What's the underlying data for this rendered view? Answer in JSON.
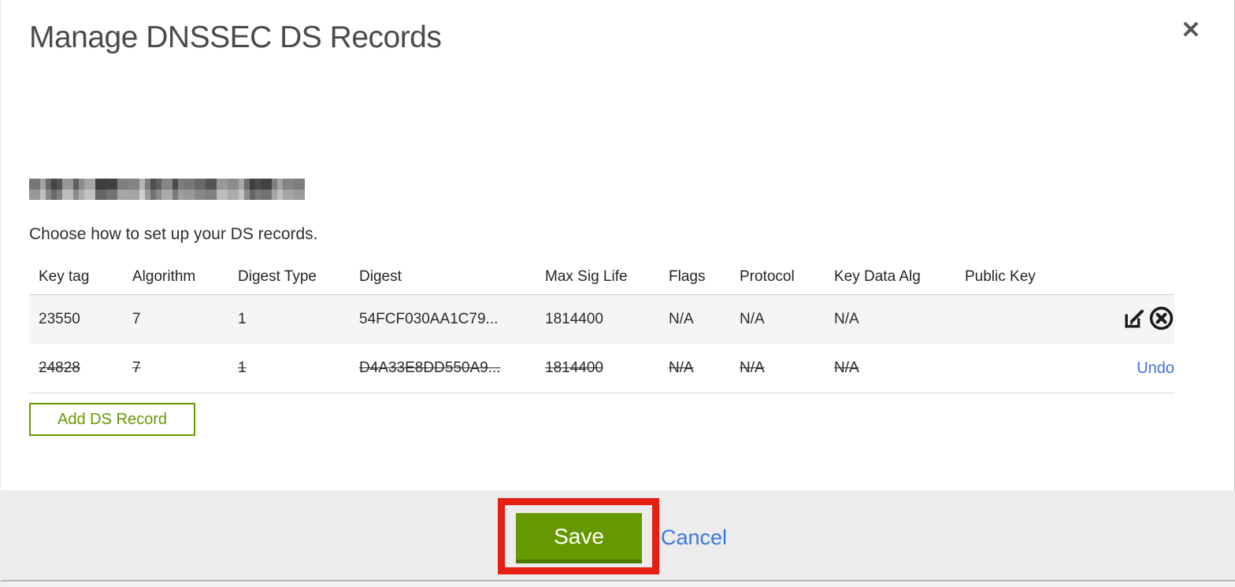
{
  "modal": {
    "title": "Manage DNSSEC DS Records",
    "close_icon": "✕",
    "instruction": "Choose how to set up your DS records.",
    "domain_redacted": true
  },
  "table": {
    "columns": [
      "Key tag",
      "Algorithm",
      "Digest Type",
      "Digest",
      "Max Sig Life",
      "Flags",
      "Protocol",
      "Key Data Alg",
      "Public Key"
    ],
    "rows": [
      {
        "key_tag": "23550",
        "algorithm": "7",
        "digest_type": "1",
        "digest": "54FCF030AA1C79...",
        "max_sig_life": "1814400",
        "flags": "N/A",
        "protocol": "N/A",
        "key_data_alg": "N/A",
        "public_key": "",
        "state": "active",
        "actions": [
          "edit",
          "delete"
        ]
      },
      {
        "key_tag": "24828",
        "algorithm": "7",
        "digest_type": "1",
        "digest": "D4A33E8DD550A9...",
        "max_sig_life": "1814400",
        "flags": "N/A",
        "protocol": "N/A",
        "key_data_alg": "N/A",
        "public_key": "",
        "state": "deleted",
        "undo_label": "Undo"
      }
    ]
  },
  "buttons": {
    "add_ds_record": "Add DS Record",
    "save": "Save",
    "cancel": "Cancel"
  },
  "colors": {
    "accent_green": "#669900",
    "accent_green_dark": "#4e7a02",
    "link_blue": "#3b77e0",
    "annotation_red": "#e71f13",
    "row_stripe": "#f5f5f6",
    "footer_gray": "#ececec"
  }
}
